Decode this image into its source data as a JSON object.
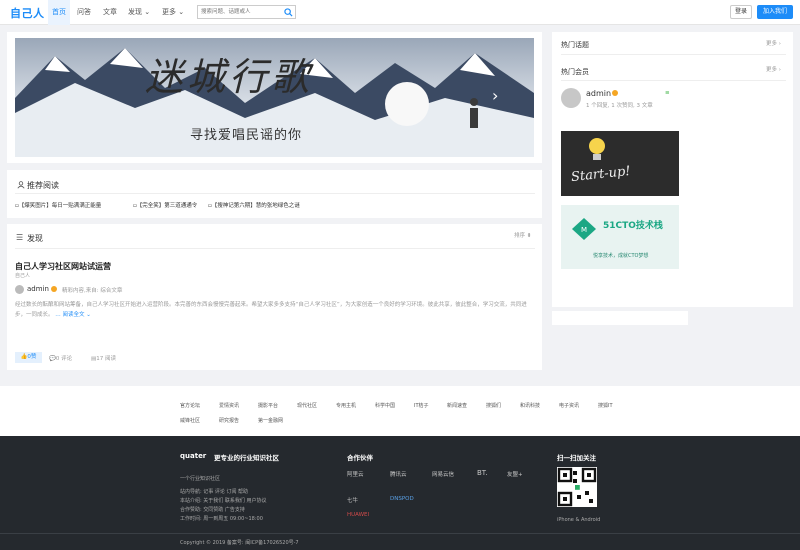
{
  "header": {
    "logo": "自己人",
    "nav": [
      "首页",
      "问答",
      "文章",
      "发现 ⌄",
      "更多 ⌄"
    ],
    "search_placeholder": "搜索问题、话题或人",
    "login": "登录",
    "join": "加入我们"
  },
  "banner": {
    "title": "迷城行歌",
    "subtitle": "寻找爱唱民谣的你"
  },
  "recommend": {
    "title": "推荐阅读",
    "items": [
      "【爆笑图片】每日一贴满满正能量",
      "【完全笑】第三道通通令",
      "【搜神记第六期】慧的张地绿色之谜"
    ]
  },
  "discover": {
    "title": "发现",
    "sort": "排序 ⬍",
    "post": {
      "title": "自己人学习社区网站试运营",
      "tag": "自己人",
      "author": "admin",
      "meta": "精彩内容,来自: 综合文章",
      "excerpt": "经过数长的酝酿和网站筹备，自己人学习社区开始进入运营阶段。本完善的东西会慢慢完善起来。希望大家多多支持“自己人学习社区”，为大家创造一个良好的学习环境。彼此共享，彼此整合，学习交流，共同进步，一同成长。",
      "read_more": "… 阅读全文 ⌄",
      "likes": "0赞",
      "comments": "0 评论",
      "views": "17 阅读"
    }
  },
  "sidebar": {
    "hot_topics": "热门话题",
    "more1": "更多 ›",
    "hot_users": "热门会员",
    "more2": "更多 ›",
    "user": {
      "name": "admin",
      "stats": "1 个回复, 1 次赞同, 3 文章"
    },
    "promo1_text": "Start-up!",
    "promo2_title": "51CTO技术栈",
    "promo2_sub": "悦享技术，成就CTO梦想"
  },
  "footer": {
    "links1": [
      "官方论坛",
      "爱情资讯",
      "摄影平台",
      "现代社区",
      "专用主机",
      "科学中国",
      "IT桔子",
      "新闻速查",
      "搜狐们",
      "和讯科技",
      "电子资讯",
      "搜狐IT"
    ],
    "links2": [
      "威锋社区",
      "研究报告",
      "第一金融网"
    ],
    "brand": "quater",
    "brand_tagline": "更专业的行业知识社区",
    "desc": "一个行业知识社区",
    "site_nav": "站内导航:",
    "site_nav_links": "记事 评论 订阅 帮助",
    "about": "本站介绍:",
    "about_links": "关于我们 联系我们 用户协议",
    "coop": "合作赞助:",
    "coop_links": "交同赞助 广告支持",
    "hours": "工作时间:",
    "hours_value": "周一到周五 09:00~18:00",
    "partners_title": "合作伙伴",
    "partners": [
      "阿里云",
      "腾讯云",
      "网易云信",
      "BT.",
      "友盟+",
      "七牛",
      "DNSPOD",
      "HUAWEI"
    ],
    "qr_title": "扫一扫加关注",
    "qr_caption": "iPhone & Android",
    "copyright": "Copyright © 2019 备案号: 闽ICP备17026520号-7"
  }
}
